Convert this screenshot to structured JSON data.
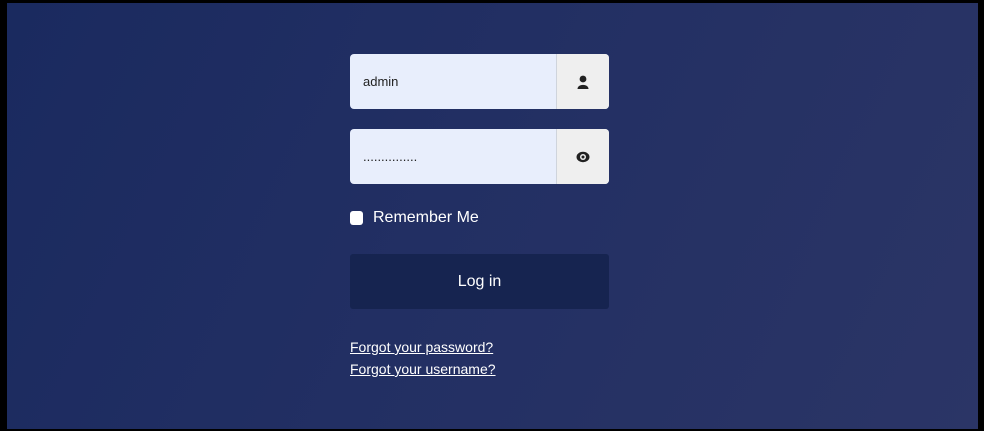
{
  "login_form": {
    "username": {
      "value": "admin",
      "icon": "user-icon"
    },
    "password": {
      "value": "...............",
      "icon": "eye-icon"
    },
    "remember_me_label": "Remember Me",
    "remember_me_checked": false,
    "login_button_label": "Log in",
    "forgot_password_link": "Forgot your password?",
    "forgot_username_link": "Forgot your username?"
  },
  "colors": {
    "background": "#1f2c60",
    "button": "#162450",
    "field": "#e8eefc"
  }
}
